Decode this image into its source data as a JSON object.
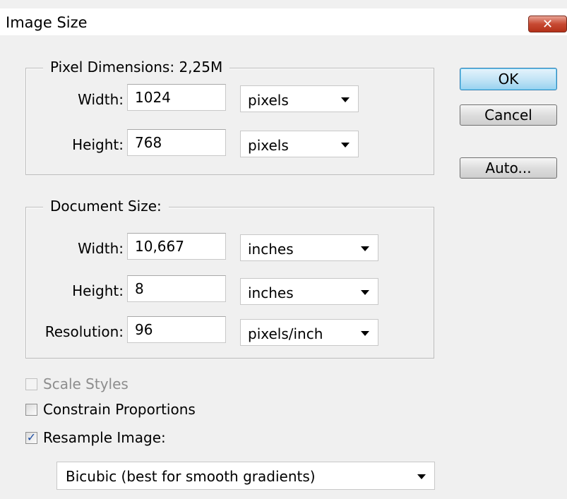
{
  "window": {
    "title": "Image Size",
    "close_glyph": "✕"
  },
  "buttons": {
    "ok": "OK",
    "cancel": "Cancel",
    "auto": "Auto..."
  },
  "pixel_dimensions": {
    "legend": "Pixel Dimensions:  2,25M",
    "width": {
      "label": "Width:",
      "value": "1024",
      "unit": "pixels"
    },
    "height": {
      "label": "Height:",
      "value": "768",
      "unit": "pixels"
    }
  },
  "document_size": {
    "legend": "Document Size:",
    "width": {
      "label": "Width:",
      "value": "10,667",
      "unit": "inches"
    },
    "height": {
      "label": "Height:",
      "value": "8",
      "unit": "inches"
    },
    "resolution": {
      "label": "Resolution:",
      "value": "96",
      "unit": "pixels/inch"
    }
  },
  "options": {
    "scale_styles": {
      "label": "Scale Styles",
      "checked": false,
      "enabled": false
    },
    "constrain_proportions": {
      "label": "Constrain Proportions",
      "checked": false,
      "enabled": true
    },
    "resample_image": {
      "label": "Resample Image:",
      "checked": true,
      "enabled": true
    },
    "resample_method": "Bicubic (best for smooth gradients)"
  },
  "colors": {
    "close_button": "#c74a33",
    "default_button": "#c4e5f6",
    "checkmark": "#1d4da3"
  }
}
